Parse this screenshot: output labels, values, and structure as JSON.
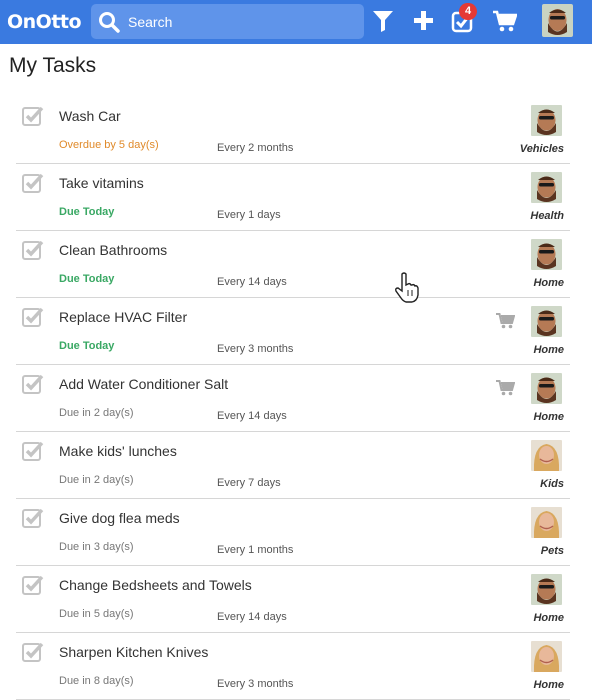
{
  "app": {
    "logo": "OnOtto"
  },
  "header": {
    "search_placeholder": "Search",
    "notification_count": "4",
    "icons": [
      "search-icon",
      "filter-icon",
      "plus-icon",
      "task-check-icon",
      "cart-icon",
      "user-avatar"
    ],
    "brand_color": "#3a7ae0"
  },
  "page": {
    "title": "My Tasks"
  },
  "tasks": [
    {
      "title": "Wash Car",
      "due": "Overdue by 5 day(s)",
      "status": "overdue",
      "frequency": "Every 2 months",
      "category": "Vehicles",
      "cart": false,
      "avatar": "man"
    },
    {
      "title": "Take vitamins",
      "due": "Due Today",
      "status": "today",
      "frequency": "Every 1 days",
      "category": "Health",
      "cart": false,
      "avatar": "man"
    },
    {
      "title": "Clean Bathrooms",
      "due": "Due Today",
      "status": "today",
      "frequency": "Every 14 days",
      "category": "Home",
      "cart": false,
      "avatar": "man"
    },
    {
      "title": "Replace HVAC Filter",
      "due": "Due Today",
      "status": "today",
      "frequency": "Every 3 months",
      "category": "Home",
      "cart": true,
      "avatar": "man"
    },
    {
      "title": "Add Water Conditioner Salt",
      "due": "Due in 2 day(s)",
      "status": "upcoming",
      "frequency": "Every 14 days",
      "category": "Home",
      "cart": true,
      "avatar": "man"
    },
    {
      "title": "Make kids' lunches",
      "due": "Due in 2 day(s)",
      "status": "upcoming",
      "frequency": "Every 7 days",
      "category": "Kids",
      "cart": false,
      "avatar": "woman"
    },
    {
      "title": "Give dog flea meds",
      "due": "Due in 3 day(s)",
      "status": "upcoming",
      "frequency": "Every 1 months",
      "category": "Pets",
      "cart": false,
      "avatar": "woman"
    },
    {
      "title": "Change Bedsheets and Towels",
      "due": "Due in 5 day(s)",
      "status": "upcoming",
      "frequency": "Every 14 days",
      "category": "Home",
      "cart": false,
      "avatar": "man"
    },
    {
      "title": "Sharpen Kitchen Knives",
      "due": "Due in 8 day(s)",
      "status": "upcoming",
      "frequency": "Every 3 months",
      "category": "Home",
      "cart": false,
      "avatar": "woman"
    }
  ],
  "colors": {
    "overdue": "#e08a2a",
    "today": "#3aa864"
  }
}
